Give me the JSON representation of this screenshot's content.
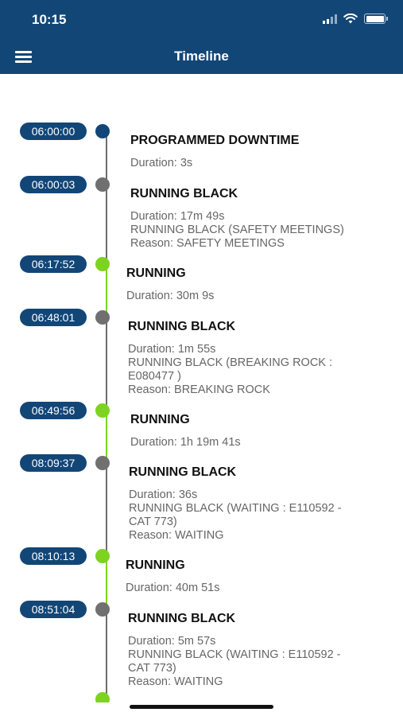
{
  "status_bar": {
    "time": "10:15"
  },
  "header": {
    "title": "Timeline",
    "menu_icon": "hamburger-menu-icon"
  },
  "colors": {
    "header": "#124677",
    "dot_blue": "#124677",
    "dot_grey": "#707070",
    "dot_green": "#7ed321"
  },
  "events": [
    {
      "time": "06:00:00",
      "status": "PROGRAMMED DOWNTIME",
      "color": "blue",
      "lines": [
        "Duration: 3s"
      ]
    },
    {
      "time": "06:00:03",
      "status": "RUNNING BLACK",
      "color": "grey",
      "lines": [
        "Duration: 17m 49s",
        "RUNNING BLACK (SAFETY MEETINGS)",
        "Reason: SAFETY MEETINGS"
      ]
    },
    {
      "time": "06:17:52",
      "status": "RUNNING",
      "color": "green",
      "lines": [
        "Duration: 30m 9s"
      ]
    },
    {
      "time": "06:48:01",
      "status": "RUNNING BLACK",
      "color": "grey",
      "lines": [
        "Duration: 1m 55s",
        "RUNNING BLACK (BREAKING ROCK :",
        "E080477 )",
        "Reason: BREAKING ROCK"
      ]
    },
    {
      "time": "06:49:56",
      "status": "RUNNING",
      "color": "green",
      "lines": [
        "Duration: 1h 19m 41s"
      ]
    },
    {
      "time": "08:09:37",
      "status": "RUNNING BLACK",
      "color": "grey",
      "lines": [
        "Duration: 36s",
        "RUNNING BLACK (WAITING : E110592 -",
        "CAT 773)",
        "Reason: WAITING"
      ]
    },
    {
      "time": "08:10:13",
      "status": "RUNNING",
      "color": "green",
      "lines": [
        "Duration: 40m 51s"
      ]
    },
    {
      "time": "08:51:04",
      "status": "RUNNING BLACK",
      "color": "grey",
      "lines": [
        "Duration: 5m 57s",
        "RUNNING BLACK (WAITING : E110592 -",
        "CAT 773)",
        "Reason: WAITING"
      ]
    },
    {
      "time": "",
      "status": "",
      "color": "green",
      "lines": []
    }
  ]
}
